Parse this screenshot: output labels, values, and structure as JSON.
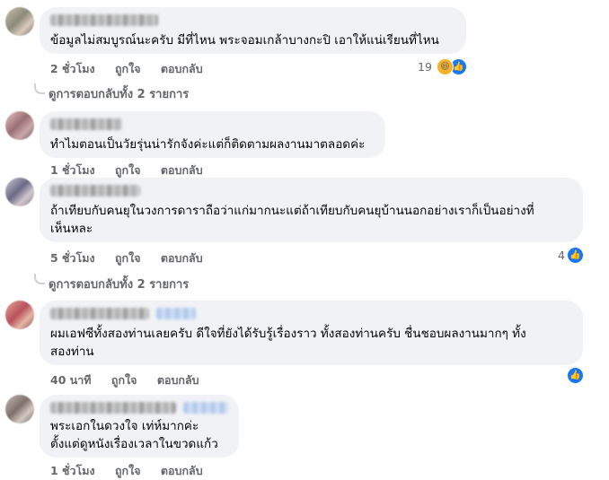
{
  "comments": [
    {
      "text": "ข้อมูลไม่สมบูรณ์นะครับ มีที่ไหน พระจอมเกล้าบางกะปิ เอาให้แน่เรียนที่ไหน",
      "time": "2 ชั่วโมง",
      "like": "ถูกใจ",
      "reply": "ตอบกลับ",
      "reaction_count": "19",
      "reactions": [
        "haha-icon",
        "like-icon"
      ],
      "replies_link": "ดูการตอบกลับทั้ง 2 รายการ"
    },
    {
      "text": "ทำไมตอนเป็นวัยรุ่นน่ารักจังค่ะแต่ก็ติดตามผลงานมาตลอดค่ะ",
      "time": "1 ชั่วโมง",
      "like": "ถูกใจ",
      "reply": "ตอบกลับ"
    },
    {
      "text_line1": "ถ้าเทียบกับคนยุในวงการดาราถือว่าแก่มากนะแต่ถ้าเทียบกับคนยุบ้านนอกอย่างเราก็เป็นอย่างที่",
      "text_line2": "เห็นหละ",
      "time": "5 ชั่วโมง",
      "like": "ถูกใจ",
      "reply": "ตอบกลับ",
      "reaction_count": "4",
      "replies_link": "ดูการตอบกลับทั้ง 2 รายการ"
    },
    {
      "text_line1": "ผมเอฟซีทั้งสองท่านเลยครับ ดีใจที่ยังได้รับรู้เรื่องราว ทั้งสองท่านครับ ชื่นชอบผลงานมากๆ ทั้ง",
      "text_line2": "สองท่าน",
      "time": "40 นาที",
      "like": "ถูกใจ",
      "reply": "ตอบกลับ"
    },
    {
      "text_line1": "พระเอกในดวงใจ เท่ห์มากค่ะ",
      "text_line2": "ตั้งแต่ดูหนังเรื่องเวลาในขวดแก้ว",
      "time": "1 ชั่วโมง",
      "like": "ถูกใจ",
      "reply": "ตอบกลับ"
    }
  ],
  "colors": {
    "bubble": "#f0f2f5",
    "meta": "#65676b",
    "like_blue": "#1877f2"
  }
}
